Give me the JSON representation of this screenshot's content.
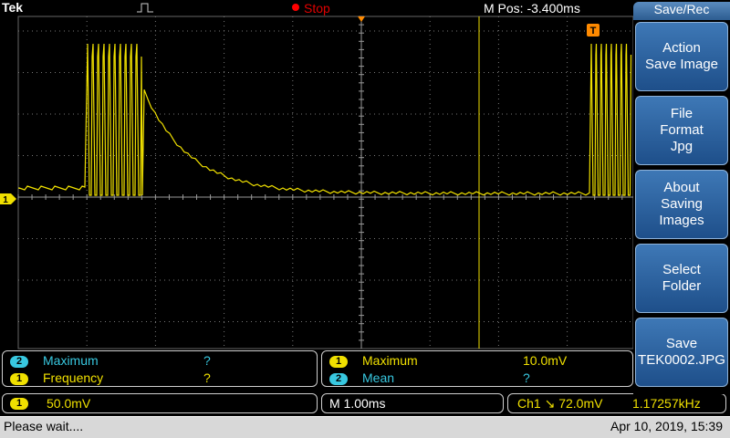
{
  "header": {
    "brand": "Tek",
    "run_state": "Stop",
    "position_label": "M Pos: -3.400ms"
  },
  "menu": {
    "title": "Save/Rec",
    "buttons": [
      {
        "lines": [
          "Action",
          "Save Image"
        ]
      },
      {
        "lines": [
          "File",
          "Format",
          "Jpg"
        ]
      },
      {
        "lines": [
          "About",
          "Saving",
          "Images"
        ]
      },
      {
        "lines": [
          "Select",
          "Folder"
        ]
      },
      {
        "lines": [
          "Save",
          "TEK0002.JPG"
        ]
      }
    ]
  },
  "measurements": {
    "left": [
      {
        "channel": "2",
        "name": "Maximum",
        "value": "?"
      },
      {
        "channel": "1",
        "name": "Frequency",
        "value": "?"
      }
    ],
    "right": [
      {
        "channel": "1",
        "name": "Maximum",
        "value": "10.0mV"
      },
      {
        "channel": "2",
        "name": "Mean",
        "value": "?"
      }
    ]
  },
  "status": {
    "ch1_scale_channel": "1",
    "ch1_scale": "50.0mV",
    "timebase": "M 1.00ms",
    "trigger": "Ch1 ↘ 72.0mV",
    "trigger_freq": "1.17257kHz"
  },
  "footer": {
    "message": "Please wait....",
    "datetime": "Apr 10, 2019, 15:39"
  },
  "markers": {
    "trigger_marker": "T",
    "ch1_ground": "1"
  },
  "colors": {
    "ch1": "#f0e000",
    "ch2": "#38c8e0",
    "stop": "#e00000",
    "menu": "#2c5c90"
  }
}
